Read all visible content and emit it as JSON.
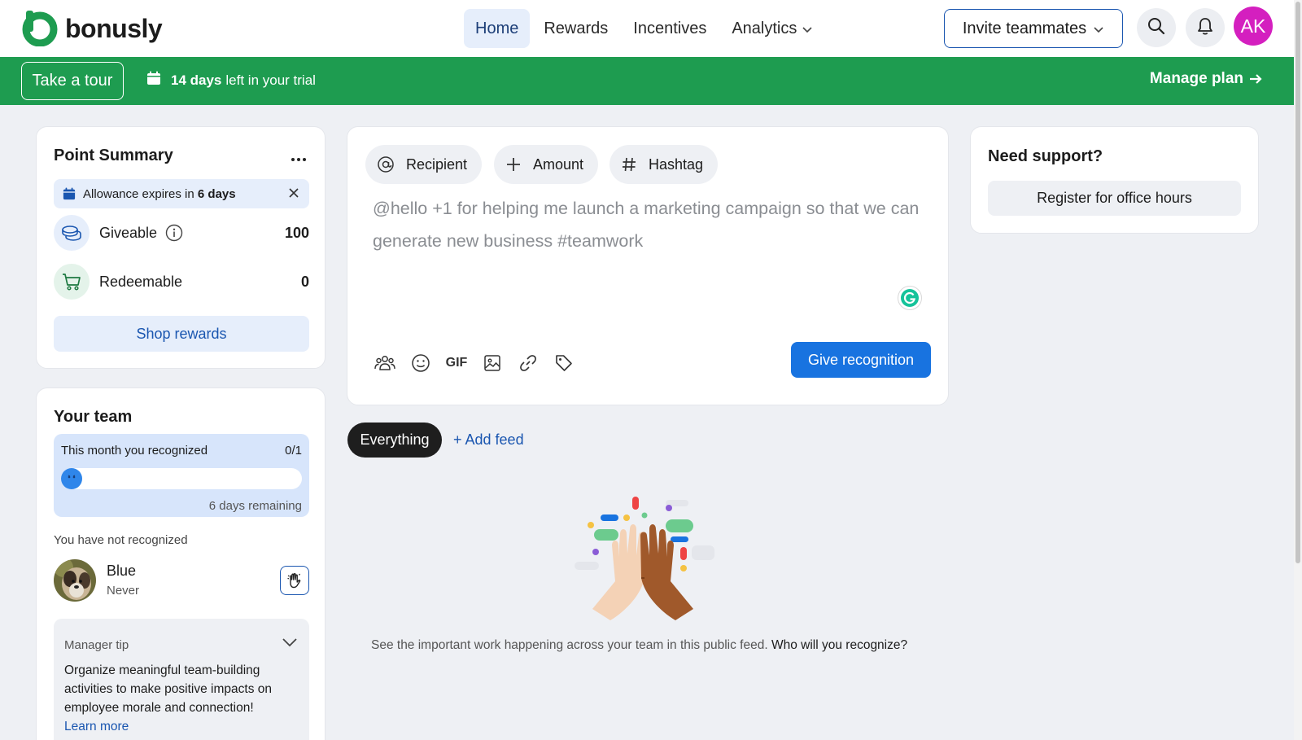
{
  "brand": {
    "name": "bonusly",
    "color": "#1e9c50"
  },
  "nav": {
    "items": [
      {
        "label": "Home",
        "active": true
      },
      {
        "label": "Rewards"
      },
      {
        "label": "Incentives"
      },
      {
        "label": "Analytics"
      }
    ],
    "invite_label": "Invite teammates",
    "avatar_initials": "AK"
  },
  "banner": {
    "tour_label": "Take a tour",
    "trial_days": "14 days",
    "trial_suffix": "left in your trial",
    "manage_label": "Manage plan"
  },
  "point_summary": {
    "title": "Point Summary",
    "allowance_prefix": "Allowance expires in",
    "allowance_days": "6 days",
    "giveable_label": "Giveable",
    "giveable_value": "100",
    "redeemable_label": "Redeemable",
    "redeemable_value": "0",
    "shop_label": "Shop rewards"
  },
  "team": {
    "title": "Your team",
    "progress_label": "This month you recognized",
    "progress_count": "0/1",
    "progress_fraction": 0,
    "days_remaining": "6 days remaining",
    "not_recognized_label": "You have not recognized",
    "member": {
      "name": "Blue",
      "last": "Never"
    },
    "tip_label": "Manager tip",
    "tip_body": "Organize meaningful team-building activities to make positive impacts on employee morale and connection!",
    "tip_link": "Learn more"
  },
  "composer": {
    "chips": [
      {
        "label": "Recipient",
        "icon": "at-icon"
      },
      {
        "label": "Amount",
        "icon": "plus-icon"
      },
      {
        "label": "Hashtag",
        "icon": "hash-icon"
      }
    ],
    "placeholder": "@hello +1 for helping me launch a marketing campaign so that we can generate new business #teamwork",
    "gif_label": "GIF",
    "give_label": "Give recognition"
  },
  "feed": {
    "tab_label": "Everything",
    "add_feed_label": "+ Add feed",
    "empty_text": "See the important work happening across your team in this public feed.",
    "empty_cta": "Who will you recognize?"
  },
  "support": {
    "title": "Need support?",
    "office_label": "Register for office hours"
  }
}
